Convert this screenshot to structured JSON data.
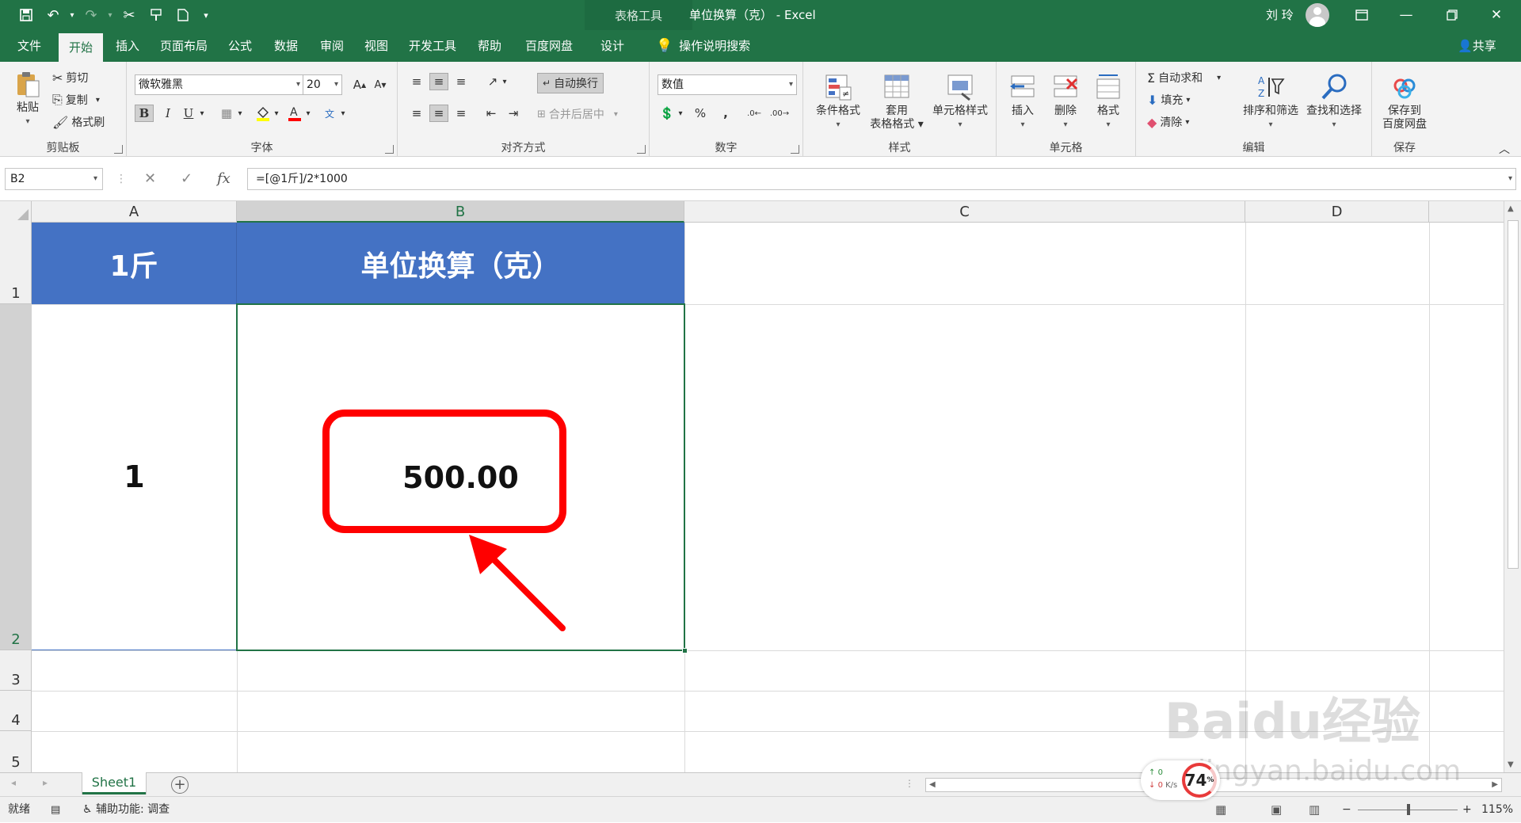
{
  "window": {
    "contextual_tools": "表格工具",
    "title": "单位换算（克）  -  Excel",
    "user": "刘 玲"
  },
  "tabs": [
    "文件",
    "开始",
    "插入",
    "页面布局",
    "公式",
    "数据",
    "审阅",
    "视图",
    "开发工具",
    "帮助",
    "百度网盘",
    "设计"
  ],
  "active_tab": "开始",
  "tell_me": "操作说明搜索",
  "share": "共享",
  "ribbon": {
    "clipboard": {
      "label": "剪贴板",
      "paste": "粘贴",
      "cut": "剪切",
      "copy": "复制",
      "format_painter": "格式刷"
    },
    "font": {
      "label": "字体",
      "font_name": "微软雅黑",
      "font_size": "20",
      "bold": "B",
      "italic": "I",
      "underline": "U"
    },
    "alignment": {
      "label": "对齐方式",
      "wrap_text": "自动换行",
      "merge_center": "合并后居中"
    },
    "number": {
      "label": "数字",
      "format": "数值",
      "percent": "%",
      "comma": ","
    },
    "styles": {
      "label": "样式",
      "conditional": "条件格式",
      "table_format_1": "套用",
      "table_format_2": "表格格式",
      "cell_styles": "单元格样式"
    },
    "cells": {
      "label": "单元格",
      "insert": "插入",
      "delete": "删除",
      "format": "格式"
    },
    "editing": {
      "label": "编辑",
      "autosum": "自动求和",
      "fill": "填充",
      "clear": "清除",
      "sort_filter": "排序和筛选",
      "find_select": "查找和选择"
    },
    "save": {
      "label": "保存",
      "save_to_1": "保存到",
      "save_to_2": "百度网盘"
    }
  },
  "formula_bar": {
    "name_box": "B2",
    "formula": "=[@1斤]/2*1000"
  },
  "columns": [
    "A",
    "B",
    "C",
    "D"
  ],
  "rows": [
    "1",
    "2",
    "3",
    "4",
    "5"
  ],
  "cells": {
    "A1": "1斤",
    "B1": "单位换算（克）",
    "A2": "1",
    "B2": "500.00"
  },
  "colors": {
    "excel_green": "#217346",
    "header_fill": "#4472c4",
    "callout": "#ff0000"
  },
  "sheet_tabs": [
    "Sheet1"
  ],
  "status": {
    "ready": "就绪",
    "accessibility": "辅助功能: 调查",
    "zoom": "115%"
  },
  "overlay": {
    "net_up": "0",
    "net_down": "0",
    "net_unit": "K/s",
    "net_percent": "74",
    "watermark": "Baidu经验",
    "watermark_url": "jingyan.baidu.com"
  }
}
